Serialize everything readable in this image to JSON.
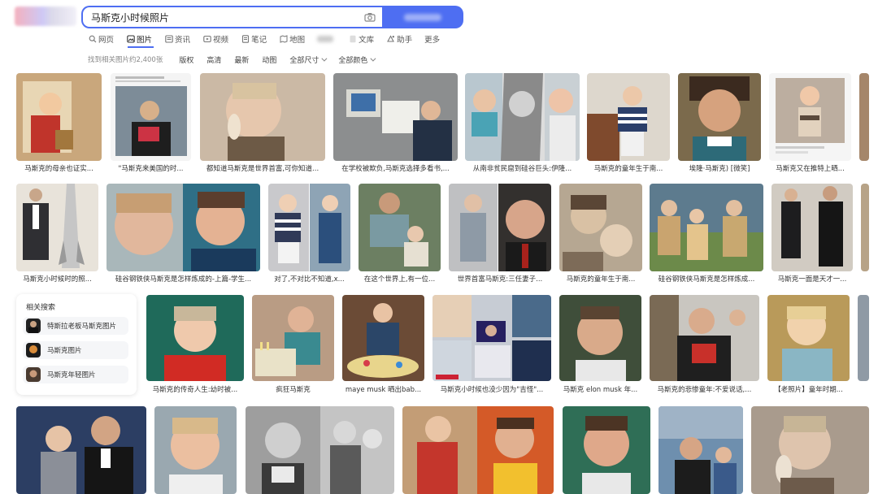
{
  "search": {
    "query": "马斯克小时候照片"
  },
  "tabs": [
    {
      "label": "网页",
      "icon": "search-icon"
    },
    {
      "label": "图片",
      "icon": "image-icon",
      "active": true
    },
    {
      "label": "资讯",
      "icon": "news-icon"
    },
    {
      "label": "视频",
      "icon": "video-icon"
    },
    {
      "label": "笔记",
      "icon": "note-icon"
    },
    {
      "label": "地图",
      "icon": "map-icon"
    },
    {
      "label": "",
      "icon": "blurred-icon"
    },
    {
      "label": "文库",
      "icon": "doc-icon"
    },
    {
      "label": "助手",
      "icon": "assistant-icon"
    },
    {
      "label": "更多",
      "icon": ""
    }
  ],
  "filters": {
    "result_count": "找到相关图片约2,400张",
    "items": [
      "版权",
      "高清",
      "最新",
      "动图",
      "全部尺寸",
      "全部颜色"
    ]
  },
  "colors": {
    "accent": "#4e6ef2"
  },
  "related": {
    "title": "相关搜索",
    "items": [
      {
        "label": "特斯拉老板马斯克图片"
      },
      {
        "label": "马斯克图片"
      },
      {
        "label": "马斯克年轻图片"
      }
    ]
  },
  "rows": [
    {
      "captions": [
        "马斯克的母亲也证实...",
        "\"马斯克来美国的时...",
        "都知道马斯克是世界首富,可你知道...",
        "在学校被欺负,马斯克选择多看书,...",
        "从南非贫民窟到硅谷巨头:伊隆...",
        "马斯克的童年生于南...",
        "埃隆·马斯克) [微笑]",
        "马斯克又在推特上晒..."
      ]
    },
    {
      "captions": [
        "马斯克小时候时的照...",
        "硅谷钢铁侠马斯克是怎样炼成的-上篇-学生...",
        "对了,不对比不知道,x...",
        "在这个世界上,有一位...",
        "世界首富马斯克:三任妻子...",
        "马斯克的童年生于南...",
        "硅谷钢铁侠马斯克是怎样炼成...",
        "马斯克一面是天才一..."
      ]
    },
    {
      "captions": [
        "马斯克的传奇人生:幼时被...",
        "疯狂马斯克",
        "maye musk 晒出bab...",
        "马斯克小时候也没少因为\"吉怪\"...",
        "马斯克 elon musk 年...",
        "马斯克的悲惨童年:不爱说话,...",
        "【老照片】童年时期..."
      ]
    }
  ]
}
